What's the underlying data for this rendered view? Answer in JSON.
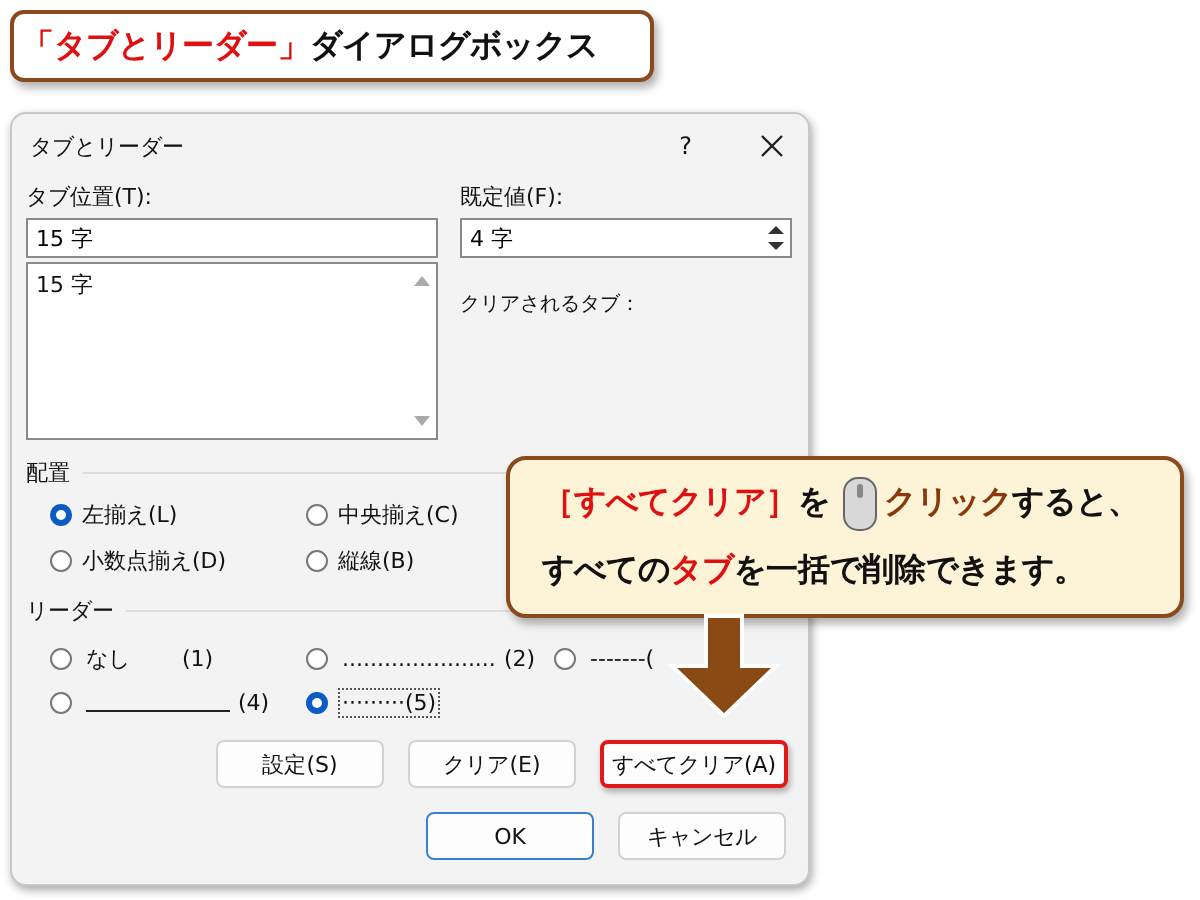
{
  "banner": {
    "segments": [
      {
        "text": "「タブとリーダー」",
        "accent": true
      },
      {
        "text": "ダイアログボックス",
        "accent": false
      }
    ]
  },
  "dialog": {
    "title": "タブとリーダー",
    "help": "?",
    "tab_position": {
      "label": "タブ位置(T):",
      "value": "15 字",
      "list": [
        "15 字"
      ]
    },
    "default_stop": {
      "label": "既定値(F):",
      "value": "4 字"
    },
    "clear_label": "クリアされるタブ：",
    "alignment": {
      "label": "配置",
      "options": [
        {
          "label": "左揃え(L)",
          "selected": true
        },
        {
          "label": "中央揃え(C)",
          "selected": false
        },
        {
          "label": "小数点揃え(D)",
          "selected": false
        },
        {
          "label": "縦線(B)",
          "selected": false
        }
      ]
    },
    "leader": {
      "label": "リーダー",
      "options": [
        {
          "kind": "text",
          "fill": "なし",
          "key": "(1)",
          "selected": false,
          "focused": false
        },
        {
          "kind": "text",
          "fill": "......................",
          "key": "(2)",
          "selected": false,
          "focused": false
        },
        {
          "kind": "text",
          "fill": "-------(",
          "selected": false,
          "focused": false
        },
        {
          "kind": "line",
          "key": "(4)",
          "selected": false,
          "focused": false
        },
        {
          "kind": "text",
          "fill": "·········",
          "key": "(5)",
          "selected": true,
          "focused": true
        }
      ]
    },
    "buttons": [
      {
        "label": "設定(S)",
        "highlighted": false
      },
      {
        "label": "クリア(E)",
        "highlighted": false
      },
      {
        "label": "すべてクリア(A)",
        "highlighted": true
      }
    ],
    "footer_buttons": [
      {
        "label": "OK",
        "default": true
      },
      {
        "label": "キャンセル",
        "default": false
      }
    ]
  },
  "callout": {
    "lines": [
      [
        {
          "kind": "text",
          "text": "［すべてクリア］",
          "color": "#e01010"
        },
        {
          "kind": "text",
          "text": "を",
          "color": "#111111"
        },
        {
          "kind": "icon"
        },
        {
          "kind": "text",
          "text": "クリック",
          "color": "#8a3a0a"
        },
        {
          "kind": "text",
          "text": "すると、",
          "color": "#111111"
        }
      ],
      [
        {
          "kind": "text",
          "text": "すべての",
          "color": "#111111"
        },
        {
          "kind": "text",
          "text": "タブ",
          "color": "#e01010"
        },
        {
          "kind": "text",
          "text": "を一括で削除できます。",
          "color": "#111111"
        }
      ]
    ]
  }
}
